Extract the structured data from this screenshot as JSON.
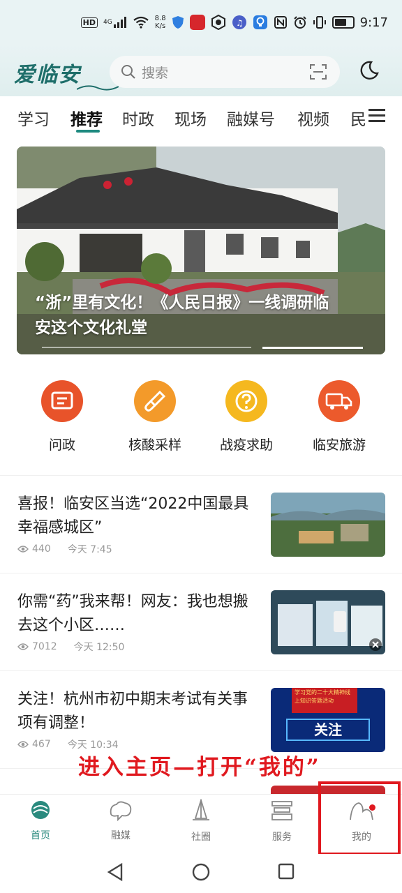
{
  "status_bar": {
    "hd": "HD",
    "signal": "4G",
    "speed_value": "8.8",
    "speed_unit": "K/s",
    "time": "9:17",
    "battery_level": 0.7
  },
  "header": {
    "logo": "爱临安",
    "search_placeholder": "搜索"
  },
  "tabs": [
    "学习",
    "推荐",
    "时政",
    "现场",
    "融媒号",
    "视频",
    "民"
  ],
  "active_tab": "推荐",
  "banner": {
    "title_line1": "“浙”里有文化！《人民日报》一线调研临",
    "title_line2": "安这个文化礼堂"
  },
  "quick_links": [
    {
      "label": "问政",
      "icon": "document-icon",
      "color": "#e8532a"
    },
    {
      "label": "核酸采样",
      "icon": "test-tube-icon",
      "color": "#f39a2a"
    },
    {
      "label": "战疫求助",
      "icon": "question-icon",
      "color": "#f5b81f"
    },
    {
      "label": "临安旅游",
      "icon": "truck-icon",
      "color": "#ec5a2c"
    }
  ],
  "news": [
    {
      "title": "喜报！临安区当选“2022中国最具幸福感城区”",
      "views": "440",
      "time": "今天 7:45"
    },
    {
      "title": "你需“药”我来帮！网友：我也想搬去这个小区……",
      "views": "7012",
      "time": "今天 12:50"
    },
    {
      "title": "关注！杭州市初中期末考试有关事项有调整！",
      "views": "467",
      "time": "今天 10:34",
      "thumb_badge": "学习党的二十大精神线上知识答题活动",
      "thumb_text": "关注"
    }
  ],
  "annotation": "进入主页—打开“我的”",
  "bottom_nav": [
    {
      "label": "首页",
      "icon": "home-icon",
      "active": true
    },
    {
      "label": "融媒",
      "icon": "media-icon",
      "active": false
    },
    {
      "label": "社圈",
      "icon": "community-icon",
      "active": false
    },
    {
      "label": "服务",
      "icon": "service-icon",
      "active": false
    },
    {
      "label": "我的",
      "icon": "profile-icon",
      "active": false
    }
  ],
  "colors": {
    "accent": "#1e8a80",
    "header_bg": "#e9f3f4",
    "annotation_red": "#e0191f"
  }
}
